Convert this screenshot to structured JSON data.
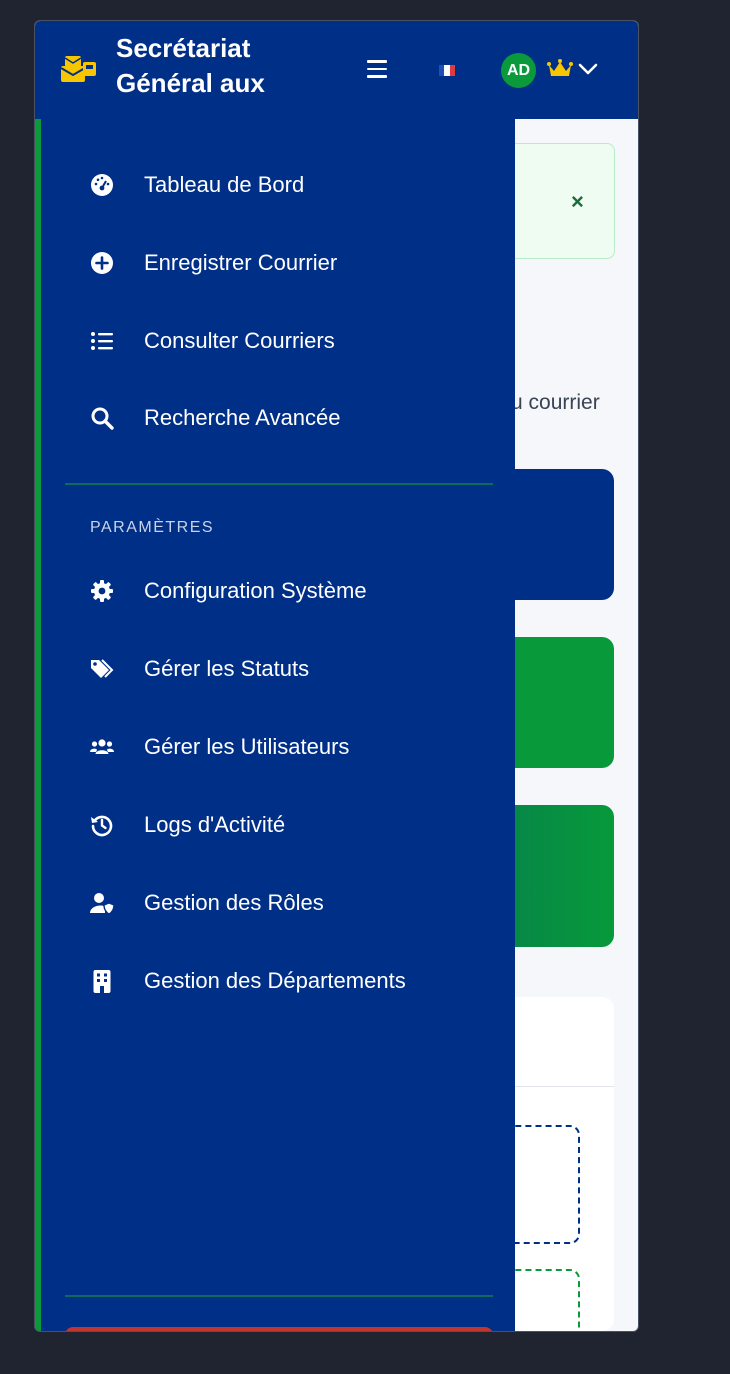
{
  "header": {
    "title": "Secrétariat Général aux",
    "avatar_initials": "AD",
    "language_flag": "fr"
  },
  "alert": {
    "close_symbol": "×"
  },
  "background": {
    "partial_text": "u courrier"
  },
  "sidebar": {
    "main_items": [
      {
        "icon": "dashboard-gauge-icon",
        "label": "Tableau de Bord"
      },
      {
        "icon": "plus-circle-icon",
        "label": "Enregistrer Courrier"
      },
      {
        "icon": "list-icon",
        "label": "Consulter Courriers"
      },
      {
        "icon": "search-icon",
        "label": "Recherche Avancée"
      }
    ],
    "section_title": "PARAMÈTRES",
    "settings_items": [
      {
        "icon": "gear-icon",
        "label": "Configuration Système"
      },
      {
        "icon": "tags-icon",
        "label": "Gérer les Statuts"
      },
      {
        "icon": "users-icon",
        "label": "Gérer les Utilisateurs"
      },
      {
        "icon": "history-icon",
        "label": "Logs d'Activité"
      },
      {
        "icon": "user-shield-icon",
        "label": "Gestion des Rôles"
      },
      {
        "icon": "building-icon",
        "label": "Gestion des Départements"
      }
    ]
  },
  "colors": {
    "primary": "#002f87",
    "accent_green": "#0a9a3c",
    "brand_yellow": "#f7c600",
    "danger": "#c0352f"
  }
}
